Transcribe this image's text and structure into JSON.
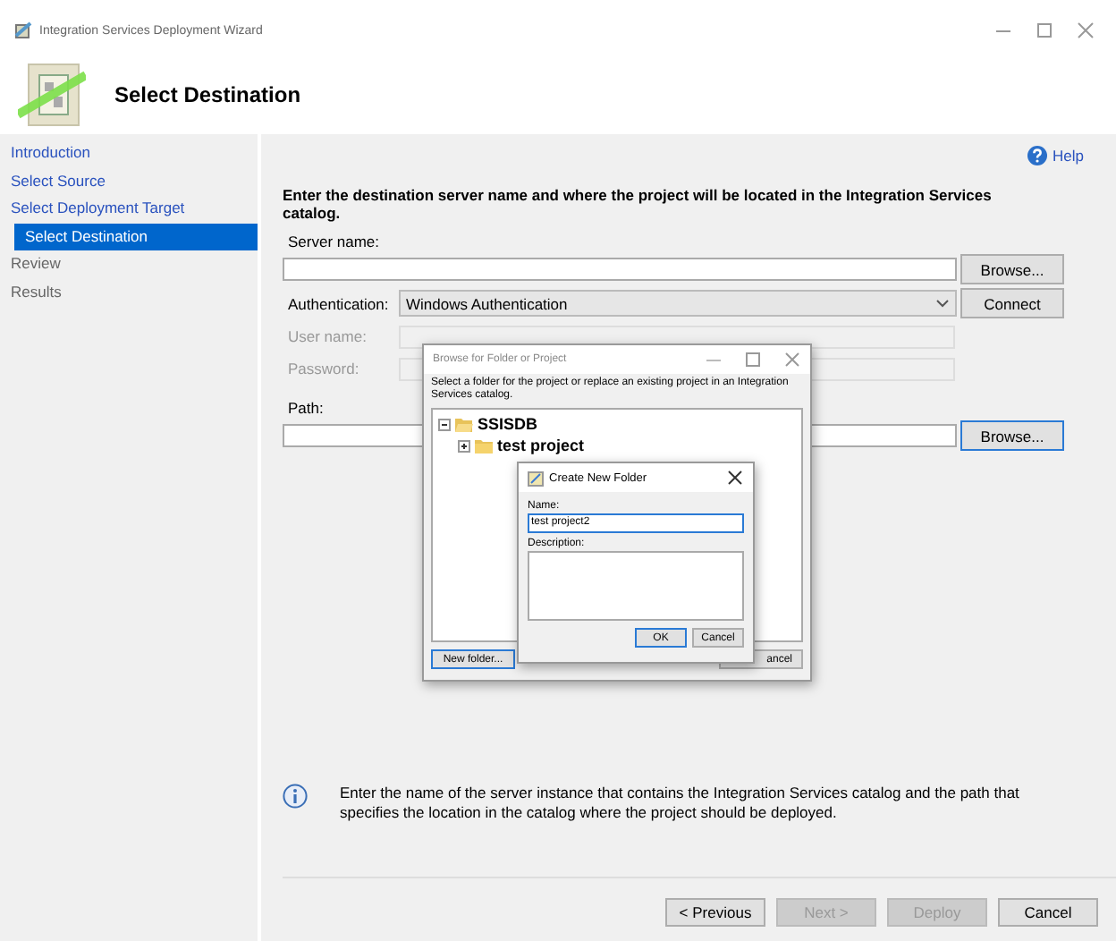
{
  "window": {
    "title": "Integration Services Deployment Wizard"
  },
  "header": {
    "title": "Select Destination"
  },
  "nav": [
    {
      "label": "Introduction",
      "enabled": true,
      "selected": false
    },
    {
      "label": "Select Source",
      "enabled": true,
      "selected": false
    },
    {
      "label": "Select Deployment Target",
      "enabled": true,
      "selected": false
    },
    {
      "label": "Select Destination",
      "enabled": true,
      "selected": true
    },
    {
      "label": "Review",
      "enabled": false,
      "selected": false
    },
    {
      "label": "Results",
      "enabled": false,
      "selected": false
    }
  ],
  "help": "Help",
  "instruction": "Enter the destination server name and where the project will be located in the Integration Services catalog.",
  "server": {
    "label": "Server name:",
    "button": "Browse..."
  },
  "authentication": {
    "label": "Authentication:",
    "value": "Windows Authentication",
    "button": "Connect"
  },
  "user_name": {
    "label": "User name:",
    "disabled": true
  },
  "password": {
    "label": "Password:",
    "disabled": true
  },
  "path": {
    "label": "Path:",
    "button": "Browse..."
  },
  "info": "Enter the name of the server instance that contains the Integration Services catalog and the path that specifies the location in the catalog where the project should be deployed.",
  "buttons": [
    {
      "label": "< Previous",
      "disabled": false
    },
    {
      "label": "Next >",
      "disabled": true
    },
    {
      "label": "Deploy",
      "disabled": true
    },
    {
      "label": "Cancel",
      "disabled": false
    }
  ],
  "browse_dialog": {
    "title": "Browse for Folder or Project",
    "description": "Select a folder for the project or replace an existing project in an Integration Services catalog.",
    "tree": [
      {
        "label": "SSISDB",
        "expanded": true,
        "children": [
          {
            "label": "test project",
            "expanded": false
          }
        ]
      }
    ],
    "new_folder": "New folder...",
    "cancel": "ancel"
  },
  "new_folder_dialog": {
    "title": "Create New Folder",
    "name_label": "Name:",
    "name_value": "test project2",
    "description_label": "Description:",
    "ok": "OK",
    "cancel": "Cancel"
  }
}
